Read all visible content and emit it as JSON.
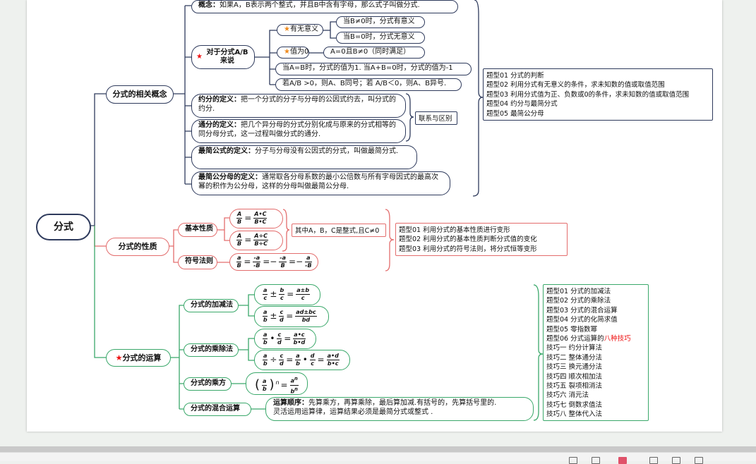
{
  "root": {
    "label": "分式"
  },
  "concepts": {
    "title": "分式的相关概念",
    "concept": {
      "label": "概念：",
      "text": "如果A，B表示两个整式，并且B中含有字母，那么式子叫做分式."
    },
    "for_fraction": {
      "label": "对于分式A/B来说"
    },
    "meaning": {
      "label": "有无意义",
      "case_nonzero": "当B≠0时，分式有意义",
      "case_zero": "当B=0时，分式无意义"
    },
    "value_zero": {
      "label": "值为0",
      "cond": "A=0且B≠0（同时满足）"
    },
    "value_one": "当A=B时，分式的值为1. 当A+B=0时，分式的值为-1",
    "sign_rule": "若A/B >0，则A、B同号；若 A/B＜0，则A、B异号.",
    "reduction": {
      "label": "约分的定义：",
      "text": "把一个分式的分子与分母的公因式约去，叫分式的约分."
    },
    "common_denom": {
      "label": "通分的定义：",
      "text": "把几个异分母的分式分别化成与原来的分式相等的同分母分式，这一过程叫做分式的通分."
    },
    "relation": "联系与区别",
    "simplest": {
      "label": "最简公式的定义：",
      "text": "分子与分母没有公因式的分式，叫做最简分式."
    },
    "simplest_denom": {
      "label": "最简公分母的定义：",
      "text": "通常取各分母系数的最小公倍数与所有字母因式的最高次幂的积作为公分母，这样的分母叫做最简公分母."
    },
    "question_types": [
      "题型01 分式的判断",
      "题型02 利用分式有无意义的条件，求未知数的值或取值范围",
      "题型03 利用分式值为正、负数或0的条件，求未知数的值或取值范围",
      "题型04 约分与最简分式",
      "题型05 最简公分母"
    ]
  },
  "properties": {
    "title": "分式的性质",
    "basic": "基本性质",
    "sign": "符号法则",
    "condition": "其中A，B，C是整式,且C≠0",
    "formula_1": {
      "lhs_num": "A",
      "lhs_den": "B",
      "rhs_num": "A•C",
      "rhs_den": "B•C"
    },
    "formula_2": {
      "lhs_num": "A",
      "lhs_den": "B",
      "rhs_num": "A÷C",
      "rhs_den": "B÷C"
    },
    "sign_formula": [
      "a",
      "B",
      "-a",
      "-B",
      "-a",
      "B",
      "a",
      "-B"
    ],
    "question_types": [
      "题型01 利用分式的基本性质进行变形",
      "题型02 利用分式的基本性质判断分式值的变化",
      "题型03 利用分式的符号法则，将分式恒等变形"
    ]
  },
  "operations": {
    "title": "分式的运算",
    "add_sub": "分式的加减法",
    "mul_div": "分式的乘除法",
    "power": "分式的乘方",
    "mixed": "分式的混合运算",
    "order_label": "运算顺序：",
    "order_text": "先算乘方，再算乘除，最后算加减.有括号的，先算括号里的.",
    "order_text2": "灵活运用运算律，运算结果必须是最简分式或整式 .",
    "formula_add1": {
      "a": "a",
      "c": "c",
      "b": "b",
      "rn": "a±b",
      "rd": "c",
      "op": "±"
    },
    "formula_add2": {
      "a": "a",
      "b": "b",
      "c": "c",
      "d": "d",
      "rn": "ad±bc",
      "rd": "bd",
      "op": "±"
    },
    "formula_mul": {
      "a": "a",
      "b": "b",
      "c": "c",
      "d": "d",
      "rn": "a•c",
      "rd": "b•d",
      "op": "•"
    },
    "formula_div": {
      "a": "a",
      "b": "b",
      "c": "c",
      "d": "d",
      "rn": "a•d",
      "rd": "b•c",
      "op": "÷"
    },
    "formula_pow": {
      "a": "a",
      "b": "b",
      "n": "n"
    },
    "question_types": [
      "题型01 分式的加减法",
      "题型02 分式的乘除法",
      "题型03 分式的混合运算",
      "题型04 分式的化简求值",
      "题型05 零指数幂"
    ],
    "qt6_prefix": "题型06 分式运算的",
    "qt6_highlight": "八种技巧",
    "techniques": [
      "技巧一 约分计算法",
      "技巧二 整体通分法",
      "技巧三 换元通分法",
      "技巧四 顺次相加法",
      "技巧五 裂项相消法",
      "技巧六 消元法",
      "技巧七 倒数求值法",
      "技巧八 整体代入法"
    ]
  },
  "colors": {
    "navy": "#2e3a5c",
    "red": "#e36d6d",
    "green": "#3aa86a",
    "highlight": "#e11111"
  }
}
